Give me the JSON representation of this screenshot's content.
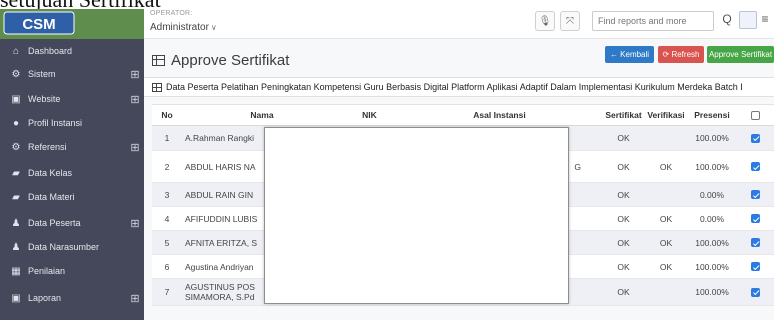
{
  "background_title": "setujuan Sertifikat",
  "sidebar": {
    "logo_text": "CSM",
    "items": [
      {
        "label": "Dashboard",
        "icon": "home-icon",
        "glyph": "⌂",
        "has_children": false
      },
      {
        "label": "Sistem",
        "icon": "cogs-icon",
        "glyph": "⚙",
        "has_children": true
      },
      {
        "label": "Website",
        "icon": "image-icon",
        "glyph": "▣",
        "has_children": true
      },
      {
        "label": "Profil Instansi",
        "icon": "circle-icon",
        "glyph": "●",
        "has_children": false
      },
      {
        "label": "Referensi",
        "icon": "cogs-icon",
        "glyph": "⚙",
        "has_children": true
      },
      {
        "label": "Data Kelas",
        "icon": "book-icon",
        "glyph": "▰",
        "has_children": false
      },
      {
        "label": "Data Materi",
        "icon": "book-icon",
        "glyph": "▰",
        "has_children": false
      },
      {
        "label": "Data Peserta",
        "icon": "user-icon",
        "glyph": "♟",
        "has_children": true
      },
      {
        "label": "Data Narasumber",
        "icon": "users-icon",
        "glyph": "♟",
        "has_children": false
      },
      {
        "label": "Penilaian",
        "icon": "table-icon",
        "glyph": "▦",
        "has_children": false
      },
      {
        "label": "Laporan",
        "icon": "image-icon",
        "glyph": "▣",
        "has_children": true
      }
    ],
    "plus_glyph": "⊞"
  },
  "topbar": {
    "operator_label": "OPERATOR:",
    "operator_name": "Administrator",
    "chevron": "∨",
    "mic_glyph": "🎙",
    "fullscreen_glyph": "⤧",
    "search_placeholder": "Find reports and more",
    "search_glyph": "Q",
    "logout_glyph": "⇥",
    "menu_glyph": "≡"
  },
  "page": {
    "title": "Approve Sertifikat",
    "back_label": "← Kembali",
    "refresh_label": "⟳ Refresh",
    "approve_label": "Approve Sertifikat",
    "panel_title": "Data Peserta Pelatihan Peningkatan Kompetensi Guru Berbasis Digital Platform Aplikasi Adaptif Dalam Implementasi Kurikulum Merdeka Batch I"
  },
  "table": {
    "headers": {
      "no": "No",
      "nama": "Nama",
      "nik": "NIK",
      "asal": "Asal Instansi",
      "sertifikat": "Sertifikat",
      "verifikasi": "Verifikasi",
      "presensi": "Presensi"
    },
    "rows": [
      {
        "no": "1",
        "nama": "A.Rahman Rangki",
        "asal_extra": "",
        "sertifikat": "OK",
        "verifikasi": "",
        "presensi": "100.00%",
        "checked": true
      },
      {
        "no": "2",
        "nama": "ABDUL HARIS NA",
        "asal_extra": "G",
        "sertifikat": "OK",
        "verifikasi": "OK",
        "presensi": "100.00%",
        "checked": true
      },
      {
        "no": "3",
        "nama": "ABDUL RAIN GIN",
        "asal_extra": "",
        "sertifikat": "OK",
        "verifikasi": "",
        "presensi": "0.00%",
        "checked": true
      },
      {
        "no": "4",
        "nama": "AFIFUDDIN LUBIS",
        "asal_extra": "",
        "sertifikat": "OK",
        "verifikasi": "OK",
        "presensi": "0.00%",
        "checked": true
      },
      {
        "no": "5",
        "nama": "AFNITA ERITZA, S",
        "asal_extra": "",
        "sertifikat": "OK",
        "verifikasi": "OK",
        "presensi": "100.00%",
        "checked": true
      },
      {
        "no": "6",
        "nama": "Agustina Andriyan",
        "asal_extra": "",
        "sertifikat": "OK",
        "verifikasi": "OK",
        "presensi": "100.00%",
        "checked": true
      },
      {
        "no": "7",
        "nama": "AGUSTINUS POS",
        "nama2": "SIMAMORA, S.Pd",
        "asal_extra": "",
        "sertifikat": "OK",
        "verifikasi": "",
        "presensi": "100.00%",
        "checked": true
      }
    ]
  },
  "colors": {
    "sidebar": "#44485a",
    "logo_bg": "#5f8d4e",
    "primary": "#2e7ac6",
    "danger": "#d9534f",
    "success": "#46a546",
    "checkbox": "#2c7be5"
  }
}
